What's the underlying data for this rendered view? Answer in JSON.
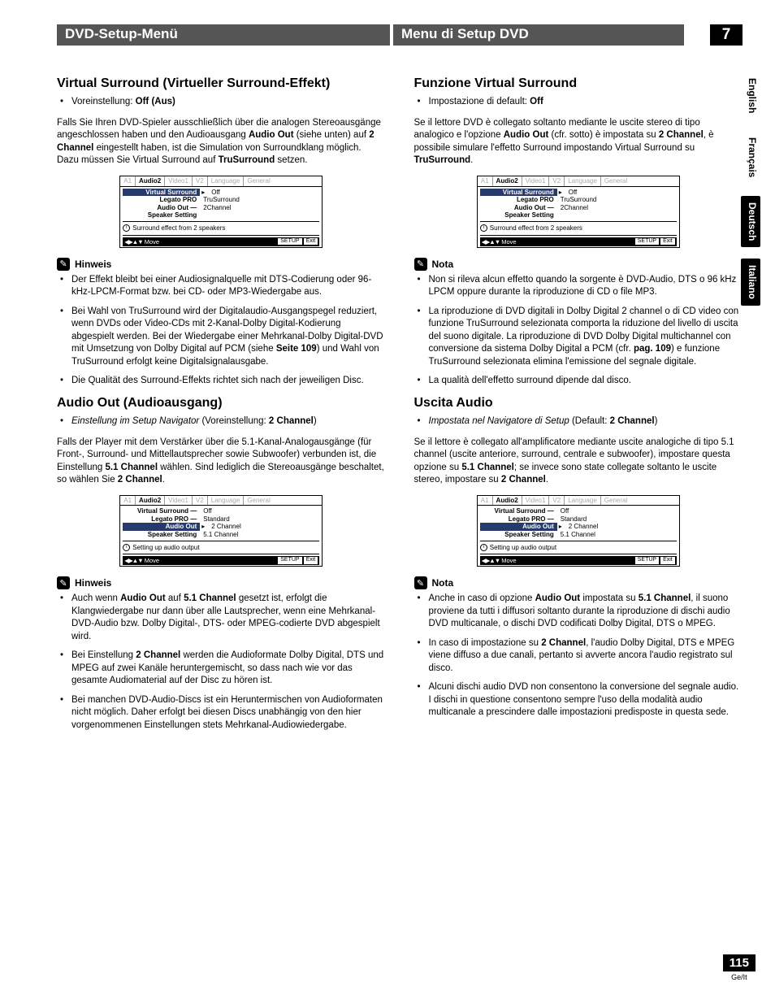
{
  "header": {
    "left": "DVD-Setup-Menü",
    "mid": "Menu di Setup DVD",
    "num": "7"
  },
  "lang_tabs": [
    "English",
    "Français",
    "Deutsch",
    "Italiano"
  ],
  "page": {
    "num": "115",
    "sub": "Ge/It"
  },
  "menu_tabs": [
    "A1",
    "Audio2",
    "Video1",
    "V2",
    "Language",
    "General"
  ],
  "menu_move": "Move",
  "menu_info1": "Surround effect from 2 speakers",
  "menu_info2": "Setting up audio output",
  "menu_setup": "SETUP",
  "menu_exit": "Exit",
  "menu_rows_vs": [
    {
      "label": "Virtual Surround",
      "val": "Off",
      "hl": true,
      "arrow": "▸"
    },
    {
      "label": "Legato PRO",
      "val": "TruSurround"
    },
    {
      "label": "Audio Out —",
      "val": "2Channel"
    },
    {
      "label": "Speaker Setting",
      "val": ""
    }
  ],
  "menu_rows_ao": [
    {
      "label": "Virtual Surround —",
      "val": "Off"
    },
    {
      "label": "Legato PRO —",
      "val": "Standard"
    },
    {
      "label": "Audio Out",
      "val": "2 Channel",
      "hl": true,
      "arrow": "▸"
    },
    {
      "label": "Speaker Setting",
      "val": "5.1 Channel"
    }
  ],
  "left": {
    "s1": {
      "title": "Virtual Surround (Virtueller Surround-Effekt)",
      "pre_label": "Voreinstellung: ",
      "pre_value": "Off (Aus)",
      "para": "Falls Sie Ihren DVD-Spieler ausschließlich über die analogen Stereoausgänge angeschlossen haben und den Audioausgang <b>Audio Out</b> (siehe unten) auf <b>2 Channel</b> eingestellt haben, ist die Simulation von Surroundklang möglich. Dazu müssen Sie Virtual Surround auf <b>TruSurround</b> setzen.",
      "note_label": "Hinweis",
      "notes": [
        "Der Effekt bleibt bei einer Audiosignalquelle mit DTS-Codierung oder 96-kHz-LPCM-Format bzw. bei CD- oder MP3-Wiedergabe aus.",
        "Bei Wahl von TruSurround wird der Digitalaudio-Ausgangspegel reduziert, wenn DVDs oder Video-CDs  mit 2-Kanal-Dolby Digital-Kodierung abgespielt werden. Bei der Wiedergabe einer Mehrkanal-Dolby Digital-DVD mit Umsetzung von Dolby Digital auf PCM (siehe <b>Seite 109</b>) und Wahl von TruSurround erfolgt keine Digitalsignalausgabe.",
        "Die Qualität des Surround-Effekts richtet sich nach der jeweiligen Disc."
      ]
    },
    "s2": {
      "title": "Audio Out (Audioausgang)",
      "pre_line": "<em>Einstellung im Setup Navigator</em> (Voreinstellung: <b>2 Channel</b>)",
      "para": "Falls der Player mit dem Verstärker über die 5.1-Kanal-Analogausgänge (für Front-, Surround- und Mittellautsprecher sowie Subwoofer) verbunden ist, die Einstellung <b>5.1 Channel</b> wählen. Sind lediglich die Stereoausgänge beschaltet, so wählen Sie <b>2 Channel</b>.",
      "note_label": "Hinweis",
      "notes": [
        "Auch wenn <b>Audio Out</b> auf <b>5.1 Channel</b> gesetzt ist, erfolgt die Klangwiedergabe nur dann über alle Lautsprecher, wenn eine Mehrkanal-DVD-Audio bzw. Dolby Digital-, DTS- oder MPEG-codierte DVD abgespielt wird.",
        "Bei Einstellung <b>2 Channel</b> werden die Audioformate Dolby Digital, DTS und MPEG auf zwei Kanäle heruntergemischt, so dass nach wie vor das gesamte Audiomaterial auf der Disc zu hören ist.",
        "Bei manchen DVD-Audio-Discs ist ein Heruntermischen von Audioformaten nicht möglich. Daher erfolgt bei diesen Discs unabhängig von den hier vorgenommenen Einstellungen stets Mehrkanal-Audiowiedergabe."
      ]
    }
  },
  "right": {
    "s1": {
      "title": "Funzione Virtual Surround",
      "pre_label": "Impostazione di default: ",
      "pre_value": "Off",
      "para": "Se il lettore DVD è collegato soltanto mediante le uscite stereo di tipo analogico e l'opzione <b>Audio Out</b> (cfr. sotto) è impostata su <b>2 Channel</b>, è possibile simulare l'effetto Surround impostando Virtual Surround su <b>TruSurround</b>.",
      "note_label": "Nota",
      "notes": [
        "Non si rileva alcun effetto quando la sorgente è DVD-Audio, DTS o 96 kHz LPCM oppure durante la riproduzione di CD o file MP3.",
        "La riproduzione di DVD digitali in Dolby Digital 2 channel o di CD video con funzione TruSurround selezionata comporta la riduzione del livello di uscita del suono digitale. La riproduzione di DVD Dolby Digital multichannel con conversione da sistema Dolby Digital a PCM (cfr. <b>pag. 109</b>) e funzione TruSurround selezionata elimina l'emissione del segnale digitale.",
        "La qualità dell'effetto surround dipende dal disco."
      ]
    },
    "s2": {
      "title": "Uscita Audio",
      "pre_line": "<em>Impostata nel Navigatore di Setup</em> (Default: <b>2 Channel</b>)",
      "para": "Se il lettore è collegato all'amplificatore mediante uscite analogiche di tipo 5.1 channel (uscite anteriore, surround, centrale e subwoofer), impostare questa opzione su <b>5.1 Channel</b>; se invece sono state collegate soltanto le uscite stereo, impostare su <b>2 Channel</b>.",
      "note_label": "Nota",
      "notes": [
        "Anche in caso di opzione <b>Audio Out</b> impostata su <b>5.1 Channel</b>, il suono proviene da tutti i diffusori soltanto durante la riproduzione di dischi audio DVD multicanale, o dischi DVD codificati Dolby Digital, DTS o MPEG.",
        "In caso di impostazione su <b>2 Channel</b>, l'audio Dolby Digital, DTS e MPEG viene diffuso a due canali, pertanto si avverte ancora l'audio registrato sul disco.",
        "Alcuni dischi audio DVD non consentono la conversione del segnale audio. I dischi in questione consentono sempre l'uso della modalità audio multicanale a prescindere dalle impostazioni predisposte in questa sede."
      ]
    }
  }
}
